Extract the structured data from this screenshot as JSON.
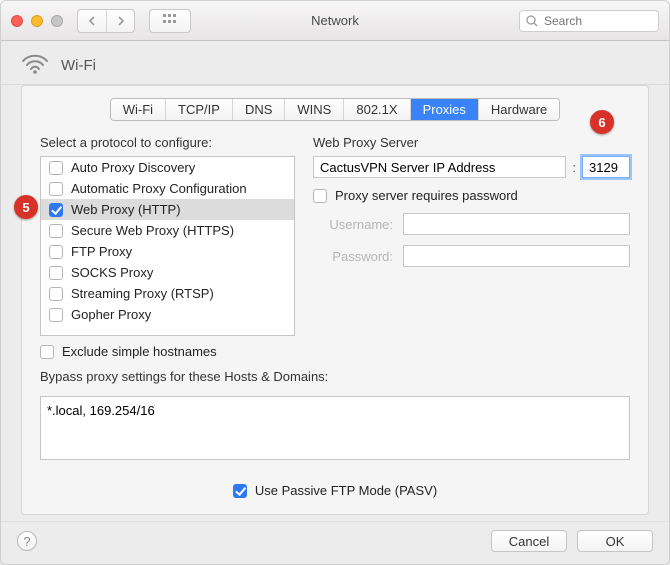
{
  "window": {
    "title": "Network",
    "search_placeholder": "Search"
  },
  "pane": {
    "name": "Wi-Fi"
  },
  "tabs": [
    "Wi-Fi",
    "TCP/IP",
    "DNS",
    "WINS",
    "802.1X",
    "Proxies",
    "Hardware"
  ],
  "active_tab": "Proxies",
  "protocol": {
    "heading": "Select a protocol to configure:",
    "items": [
      {
        "label": "Auto Proxy Discovery",
        "checked": false
      },
      {
        "label": "Automatic Proxy Configuration",
        "checked": false
      },
      {
        "label": "Web Proxy (HTTP)",
        "checked": true,
        "selected": true
      },
      {
        "label": "Secure Web Proxy (HTTPS)",
        "checked": false
      },
      {
        "label": "FTP Proxy",
        "checked": false
      },
      {
        "label": "SOCKS Proxy",
        "checked": false
      },
      {
        "label": "Streaming Proxy (RTSP)",
        "checked": false
      },
      {
        "label": "Gopher Proxy",
        "checked": false
      }
    ],
    "exclude_label": "Exclude simple hostnames",
    "exclude_checked": false
  },
  "proxy": {
    "heading": "Web Proxy Server",
    "host": "CactusVPN Server IP Address",
    "port": "3129",
    "requires_password_label": "Proxy server requires password",
    "requires_password_checked": false,
    "username_label": "Username:",
    "password_label": "Password:",
    "username": "",
    "password": ""
  },
  "bypass": {
    "heading": "Bypass proxy settings for these Hosts & Domains:",
    "value": "*.local, 169.254/16"
  },
  "pasv": {
    "label": "Use Passive FTP Mode (PASV)",
    "checked": true
  },
  "buttons": {
    "cancel": "Cancel",
    "ok": "OK"
  },
  "annotations": {
    "a5": "5",
    "a6": "6"
  }
}
